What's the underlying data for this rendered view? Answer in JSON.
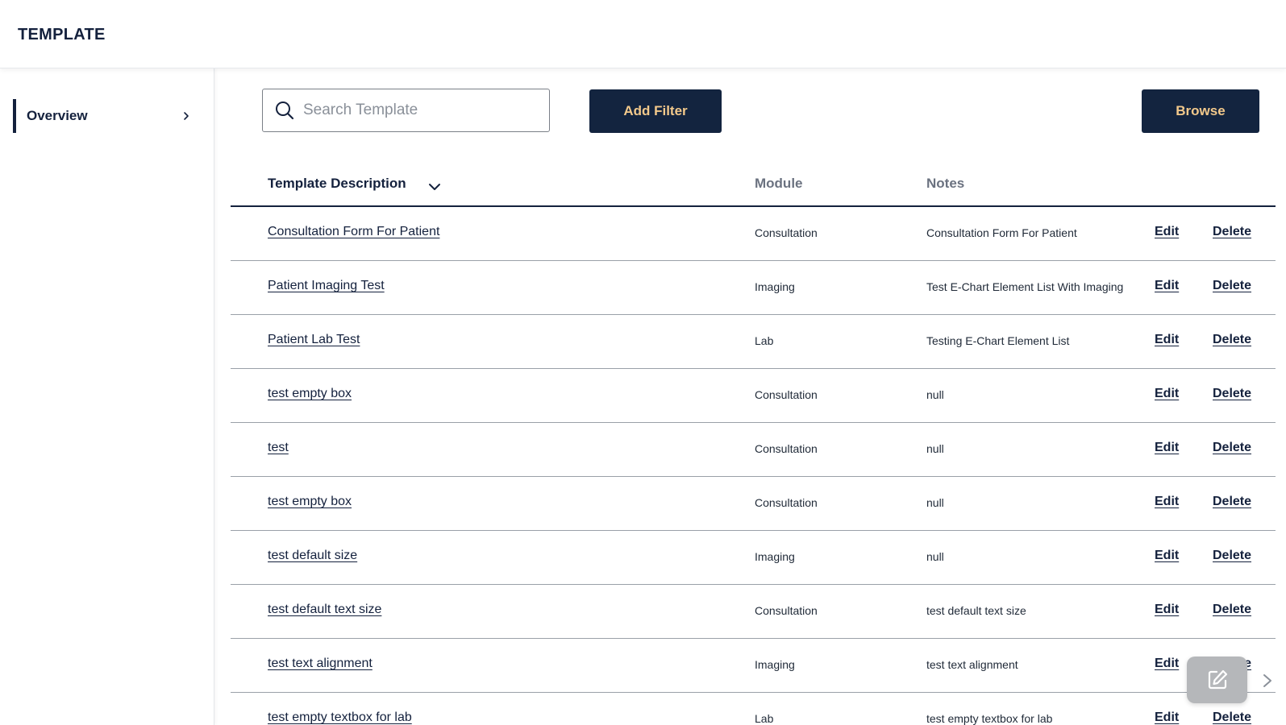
{
  "header": {
    "title": "TEMPLATE"
  },
  "sidebar": {
    "items": [
      {
        "label": "Overview"
      }
    ]
  },
  "toolbar": {
    "search_placeholder": "Search Template",
    "add_filter_label": "Add Filter",
    "browse_label": "Browse"
  },
  "table": {
    "columns": {
      "description": "Template Description",
      "module": "Module",
      "notes": "Notes"
    },
    "rows": [
      {
        "description": "Consultation Form For Patient",
        "module": "Consultation",
        "notes": "Consultation Form For Patient",
        "edit": "Edit",
        "delete": "Delete"
      },
      {
        "description": "Patient Imaging Test",
        "module": "Imaging",
        "notes": "Test E-Chart Element List With Imaging",
        "edit": "Edit",
        "delete": "Delete"
      },
      {
        "description": "Patient Lab Test",
        "module": "Lab",
        "notes": "Testing E-Chart Element List",
        "edit": "Edit",
        "delete": "Delete"
      },
      {
        "description": "test empty box",
        "module": "Consultation",
        "notes": "null",
        "edit": "Edit",
        "delete": "Delete"
      },
      {
        "description": "test",
        "module": "Consultation",
        "notes": "null",
        "edit": "Edit",
        "delete": "Delete"
      },
      {
        "description": "test empty box",
        "module": "Consultation",
        "notes": "null",
        "edit": "Edit",
        "delete": "Delete"
      },
      {
        "description": "test default size",
        "module": "Imaging",
        "notes": "null",
        "edit": "Edit",
        "delete": "Delete"
      },
      {
        "description": "test default text size",
        "module": "Consultation",
        "notes": "test default text size",
        "edit": "Edit",
        "delete": "Delete"
      },
      {
        "description": "test text alignment",
        "module": "Imaging",
        "notes": "test text alignment",
        "edit": "Edit",
        "delete": "Delete"
      },
      {
        "description": "test empty textbox for lab",
        "module": "Lab",
        "notes": "test empty textbox for lab",
        "edit": "Edit",
        "delete": "Delete"
      }
    ]
  },
  "icons": {
    "search": "search-icon",
    "sort": "chevron-down-icon",
    "sidebar_chevron": "chevron-right-icon",
    "fab": "edit-icon",
    "scroll": "chevron-right-icon"
  },
  "colors": {
    "primary": "#13243f",
    "button_text": "#f3c98b",
    "fab": "#b5b7ba"
  }
}
